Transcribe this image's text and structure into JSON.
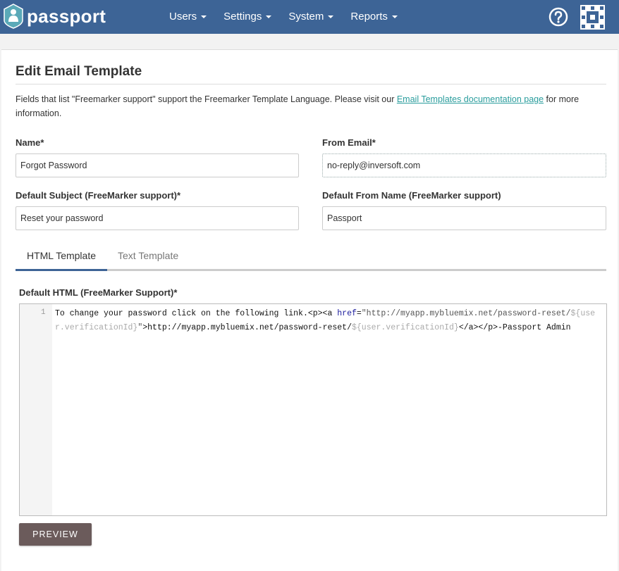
{
  "app": {
    "logo_text": "passport"
  },
  "nav": {
    "items": [
      "Users",
      "Settings",
      "System",
      "Reports"
    ]
  },
  "page": {
    "title": "Edit Email Template",
    "intro_before": "Fields that list \"Freemarker support\" support the Freemarker Template Language. Please visit our ",
    "intro_link": "Email Templates documentation page",
    "intro_after": " for more information."
  },
  "form": {
    "name": {
      "label": "Name*",
      "value": "Forgot Password"
    },
    "from_email": {
      "label": "From Email*",
      "value": "no-reply@inversoft.com"
    },
    "default_subject": {
      "label": "Default Subject (FreeMarker support)*",
      "value": "Reset your password"
    },
    "default_from_name": {
      "label": "Default From Name (FreeMarker support)",
      "value": "Passport"
    }
  },
  "tabs": [
    {
      "label": "HTML Template",
      "active": true
    },
    {
      "label": "Text Template",
      "active": false
    }
  ],
  "editor": {
    "label": "Default HTML (FreeMarker Support)*",
    "line_number": "1",
    "segments": [
      {
        "text": "To change your password click on the following link.<p><a ",
        "style": "plain"
      },
      {
        "text": "href",
        "style": "attr"
      },
      {
        "text": "=",
        "style": "plain"
      },
      {
        "text": "\"http://myapp.mybluemix.net/password-reset/",
        "style": "str"
      },
      {
        "text": "${user.verificationId}",
        "style": "tpl"
      },
      {
        "text": "\"",
        "style": "str"
      },
      {
        "text": ">http://myapp.mybluemix.net/password-reset/",
        "style": "plain"
      },
      {
        "text": "${user.verificationId}",
        "style": "tpl"
      },
      {
        "text": "</a></p>-Passport Admin",
        "style": "plain"
      }
    ]
  },
  "buttons": {
    "preview": "PREVIEW"
  },
  "colors": {
    "topbar": "#3d6496",
    "link": "#2a9d9d",
    "preview_button": "#6b5b5b"
  }
}
